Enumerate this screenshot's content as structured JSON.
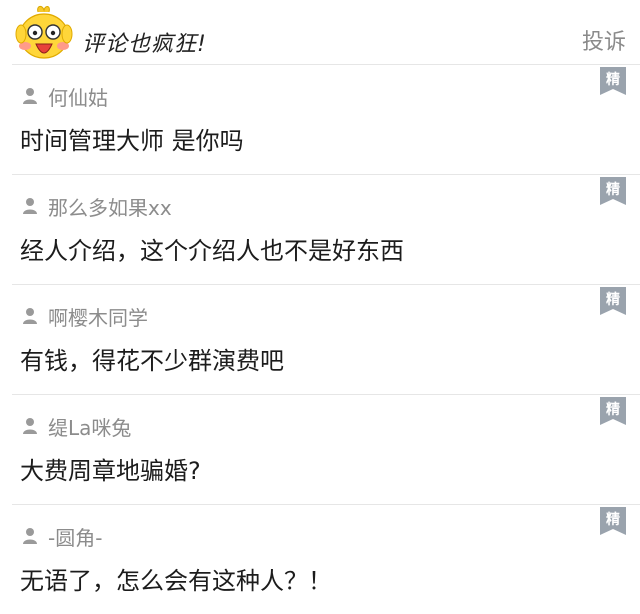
{
  "header": {
    "title": "评论也疯狂!",
    "report_label": "投诉",
    "mascot_icon": "yellow-bird-mascot"
  },
  "colors": {
    "username": "#8c8c8c",
    "divider": "#e6e6e6",
    "badge": "#9aa3ad"
  },
  "badge_label": "精",
  "comments": [
    {
      "user": "何仙姑",
      "text": "时间管理大师 是你吗"
    },
    {
      "user": "那么多如果xx",
      "text": "经人介绍，这个介绍人也不是好东西"
    },
    {
      "user": "啊樱木同学",
      "text": "有钱，得花不少群演费吧"
    },
    {
      "user": "缇La咪兔",
      "text": "大费周章地骗婚?"
    },
    {
      "user": "-圆角-",
      "text": "无语了，怎么会有这种人？！"
    }
  ]
}
